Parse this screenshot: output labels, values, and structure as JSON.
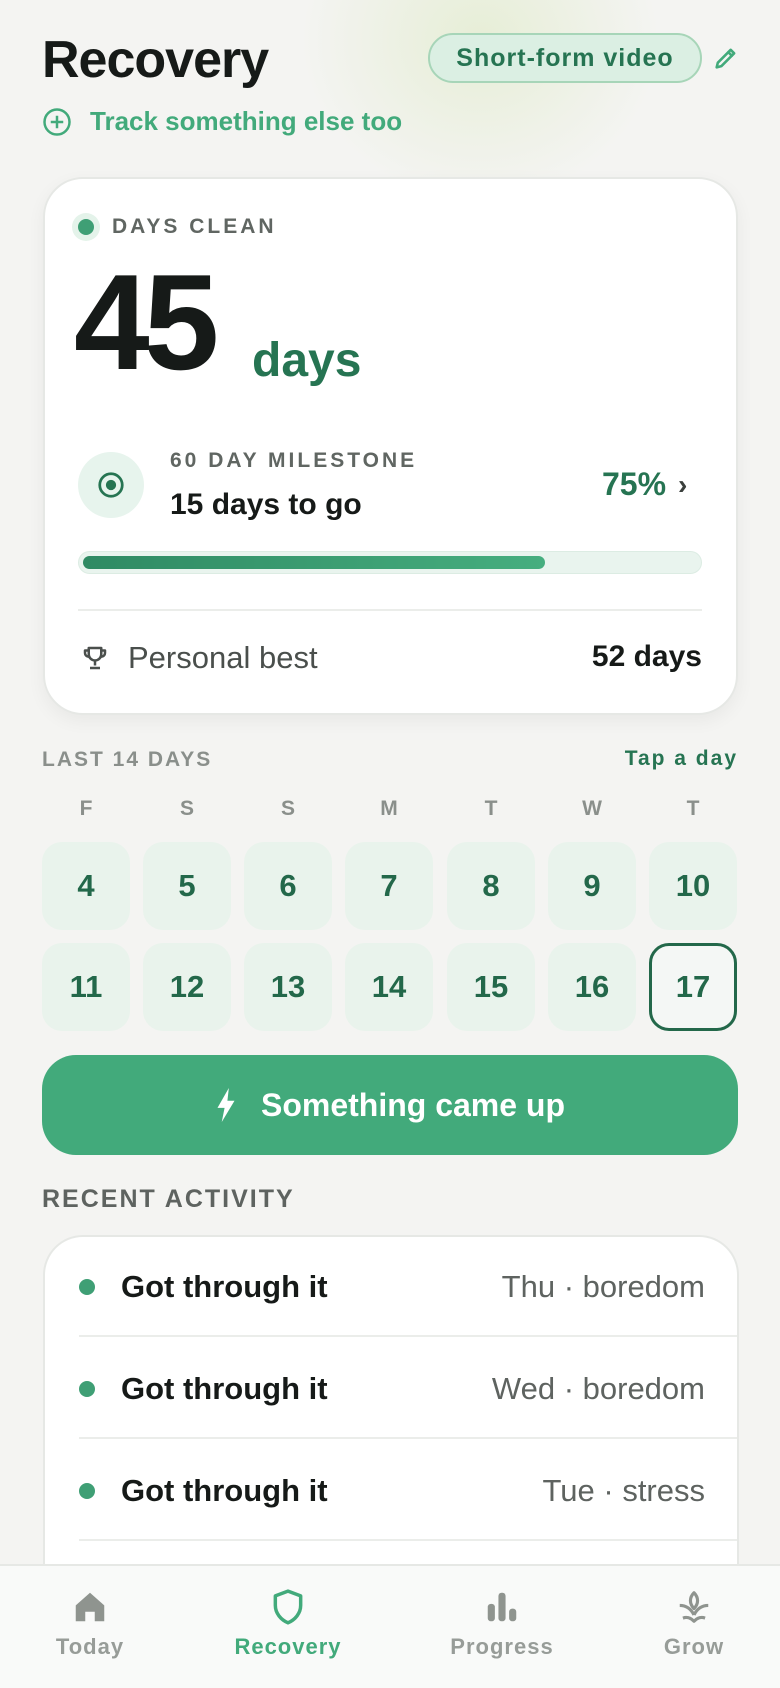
{
  "header": {
    "title": "Recovery",
    "habit_chip": "Short-form video",
    "track_link": "Track something else too"
  },
  "streak": {
    "label": "DAYS CLEAN",
    "count": "45",
    "unit": "days",
    "milestone_label": "60 DAY MILESTONE",
    "milestone_remaining": "15 days to go",
    "progress_text": "75%",
    "progress_value": 0.75,
    "personal_best_label": "Personal best",
    "personal_best_value": "52 days"
  },
  "calendar": {
    "label": "LAST 14 DAYS",
    "hint": "Tap a day",
    "weekdays": [
      "F",
      "S",
      "S",
      "M",
      "T",
      "W",
      "T"
    ],
    "days": [
      "4",
      "5",
      "6",
      "7",
      "8",
      "9",
      "10",
      "11",
      "12",
      "13",
      "14",
      "15",
      "16",
      "17"
    ],
    "selected_day": "17"
  },
  "cta": {
    "label": "Something came up"
  },
  "recent": {
    "label": "RECENT ACTIVITY",
    "items": [
      {
        "title": "Got through it",
        "meta": "Thu · boredom"
      },
      {
        "title": "Got through it",
        "meta": "Wed · boredom"
      },
      {
        "title": "Got through it",
        "meta": "Tue · stress"
      }
    ]
  },
  "nav": {
    "items": [
      {
        "label": "Today",
        "icon": "home-icon"
      },
      {
        "label": "Recovery",
        "icon": "shield-icon"
      },
      {
        "label": "Progress",
        "icon": "bar-chart-icon"
      },
      {
        "label": "Grow",
        "icon": "sprout-icon"
      }
    ],
    "active": "Recovery"
  },
  "colors": {
    "accent": "#42aa7b",
    "accent_dark": "#267452",
    "chip_bg": "#dbefe3",
    "background": "#f4f4f2"
  }
}
